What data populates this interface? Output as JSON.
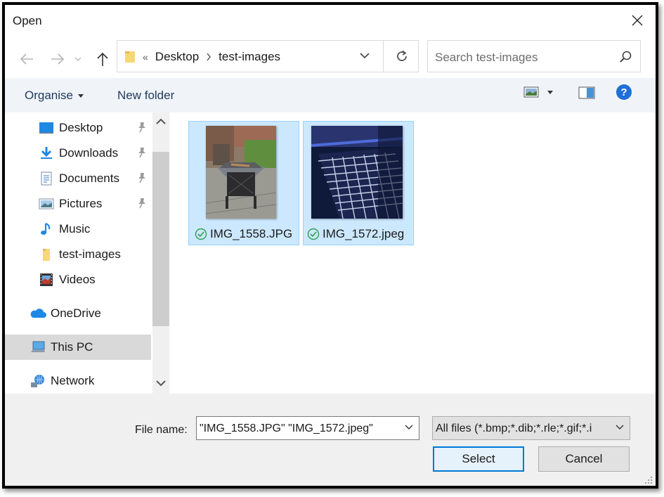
{
  "window": {
    "title": "Open"
  },
  "address": {
    "overflow": "«",
    "crumbs": [
      "Desktop",
      "test-images"
    ]
  },
  "search": {
    "placeholder": "Search test-images"
  },
  "toolbar": {
    "organise": "Organise",
    "new_folder": "New folder"
  },
  "sidebar": {
    "items": [
      {
        "label": "Desktop",
        "icon": "desktop-icon",
        "pinned": true
      },
      {
        "label": "Downloads",
        "icon": "download-arrow-icon",
        "pinned": true
      },
      {
        "label": "Documents",
        "icon": "documents-icon",
        "pinned": true
      },
      {
        "label": "Pictures",
        "icon": "pictures-icon",
        "pinned": true
      },
      {
        "label": "Music",
        "icon": "music-note-icon",
        "pinned": false
      },
      {
        "label": "test-images",
        "icon": "folder-icon",
        "pinned": false
      },
      {
        "label": "Videos",
        "icon": "videos-icon",
        "pinned": false
      },
      {
        "label": "OneDrive",
        "icon": "cloud-icon",
        "pinned": false
      },
      {
        "label": "This PC",
        "icon": "computer-icon",
        "pinned": false,
        "selected": true
      },
      {
        "label": "Network",
        "icon": "network-icon",
        "pinned": false
      }
    ]
  },
  "files": [
    {
      "name": "IMG_1558.JPG",
      "status": "synced-check-icon",
      "selected": true
    },
    {
      "name": "IMG_1572.jpeg",
      "status": "synced-check-icon",
      "selected": true
    }
  ],
  "footer": {
    "file_name_label": "File name:",
    "file_name_value": "\"IMG_1558.JPG\" \"IMG_1572.jpeg\"",
    "file_type_value": "All files (*.bmp;*.dib;*.rle;*.gif;*.i",
    "select_label": "Select",
    "cancel_label": "Cancel"
  },
  "colors": {
    "accent": "#0078d7",
    "selection_fill": "#cce8ff",
    "selection_border": "#99d1ff",
    "toolbar_bg": "#f0f4f9",
    "help_blue": "#1e6fd9"
  }
}
